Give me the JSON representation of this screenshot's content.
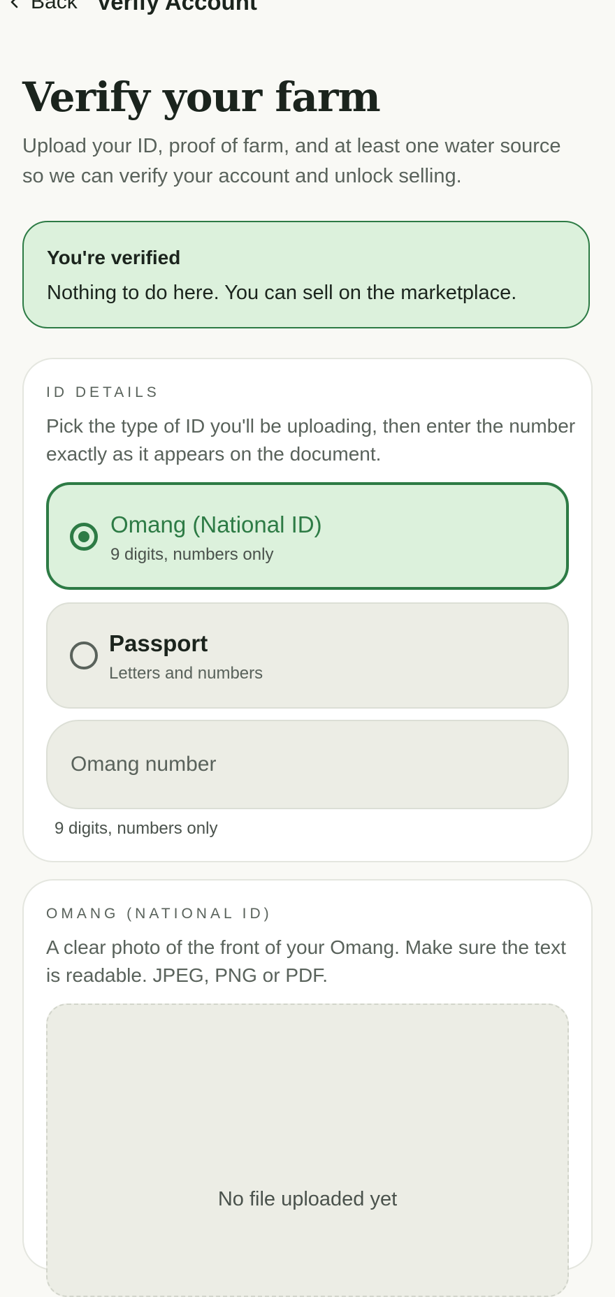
{
  "header": {
    "back_label": "Back",
    "title": "Verify Account"
  },
  "page": {
    "title": "Verify your farm",
    "subtitle": "Upload your ID, proof of farm, and at least one water source so we can verify your account and unlock selling."
  },
  "status": {
    "title": "You're verified",
    "message": "Nothing to do here. You can sell on the marketplace."
  },
  "id_details": {
    "label": "ID DETAILS",
    "description": "Pick the type of ID you'll be uploading, then enter the number exactly as it appears on the document.",
    "options": [
      {
        "title": "Omang (National ID)",
        "hint": "9 digits, numbers only",
        "selected": true
      },
      {
        "title": "Passport",
        "hint": "Letters and numbers",
        "selected": false
      }
    ],
    "number_input": {
      "placeholder": "Omang number",
      "value": "",
      "helper": "9 digits, numbers only"
    }
  },
  "omang_upload": {
    "label": "OMANG (NATIONAL ID)",
    "description": "A clear photo of the front of your Omang. Make sure the text is readable. JPEG, PNG or PDF.",
    "empty_text": "No file uploaded yet"
  },
  "colors": {
    "accent": "#2d7b45",
    "accent_bg": "#dcf1dc",
    "page_bg": "#f9f9f5"
  },
  "icons": {
    "back": "chevron-left-icon"
  }
}
